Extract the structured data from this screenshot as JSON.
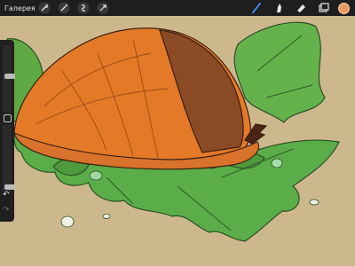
{
  "app": {
    "gallery_label": "Галерея"
  },
  "toolbar": {
    "left_tools": [
      {
        "name": "actions-wrench-icon",
        "glyph": "wrench"
      },
      {
        "name": "adjustments-wand-icon",
        "glyph": "wand"
      },
      {
        "name": "selection-icon",
        "glyph": "selection"
      },
      {
        "name": "transform-arrow-icon",
        "glyph": "arrow"
      }
    ],
    "right_tools": [
      {
        "name": "brush-icon",
        "active": true
      },
      {
        "name": "smudge-icon",
        "active": false
      },
      {
        "name": "eraser-icon",
        "active": false
      },
      {
        "name": "layers-icon",
        "active": false
      }
    ],
    "current_color": "#ee9863"
  },
  "sidebar": {
    "brush_size_level": 0.55,
    "opacity_level": 0.05,
    "undo_glyph": "↶",
    "redo_glyph": "↷"
  },
  "colors": {
    "background": "#cdb88e",
    "toolbar_bg": "#1e1e1e",
    "active_tool": "#3f86e6",
    "leaf_green": "#57a742",
    "snail_orange": "#e47a28",
    "snail_brown": "#8a4a26"
  }
}
